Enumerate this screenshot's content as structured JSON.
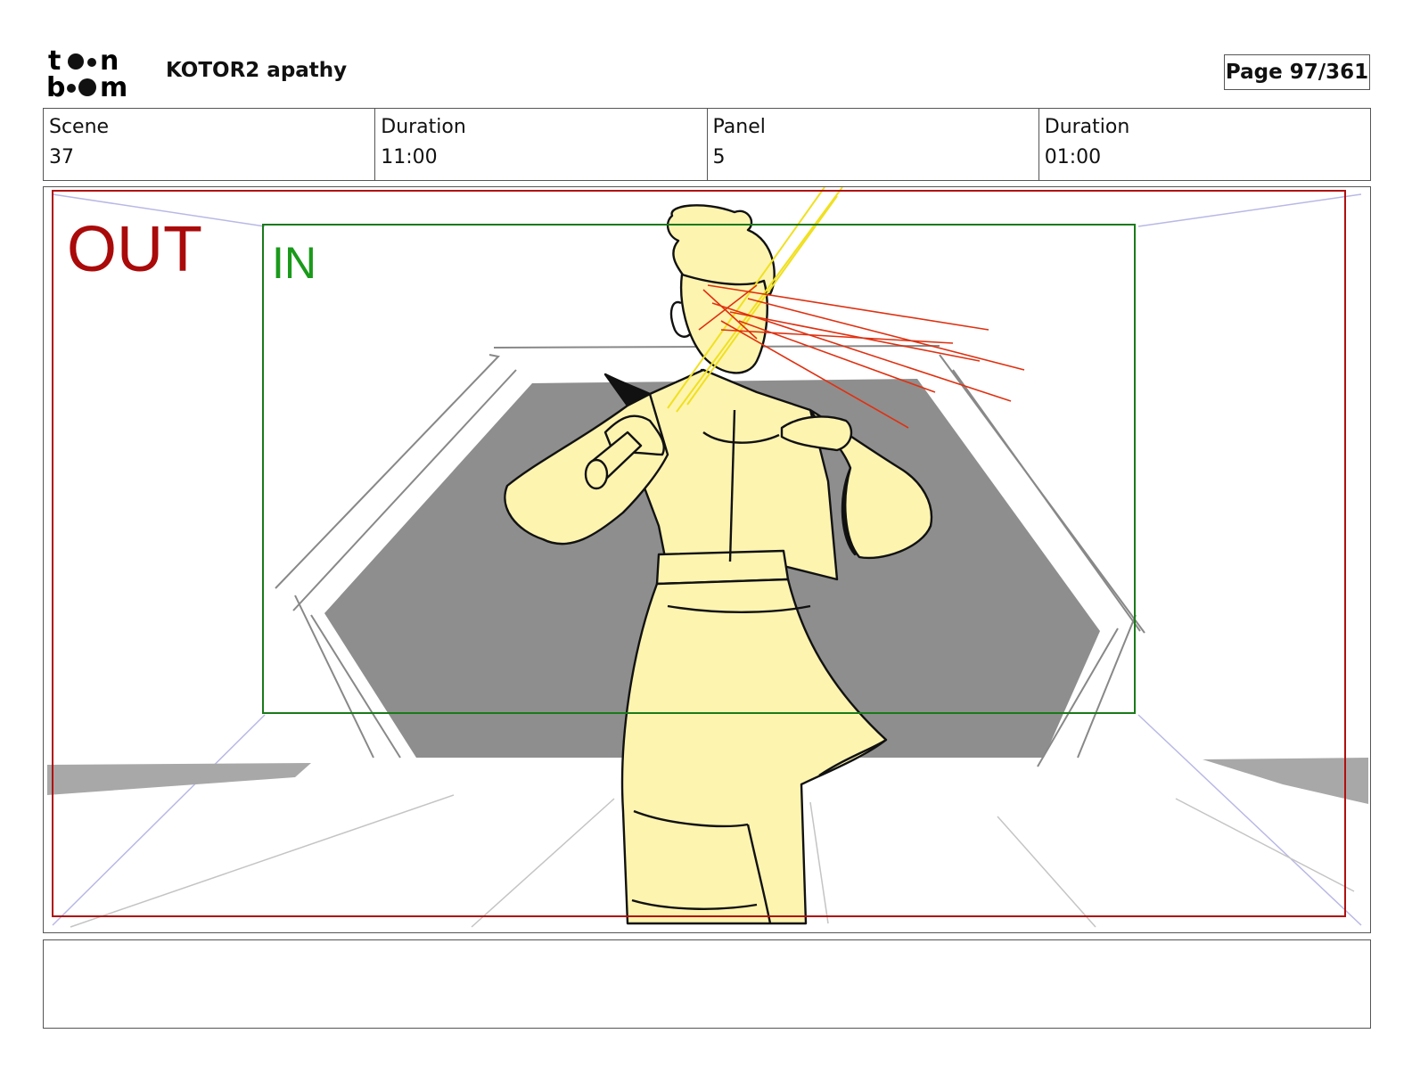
{
  "logo": {
    "text": "toon boom"
  },
  "header": {
    "project_title": "KOTOR2 apathy",
    "page_label": "Page 97/361"
  },
  "meta": {
    "scene_label": "Scene",
    "scene_value": "37",
    "duration_label": "Duration",
    "duration_value": "11:00",
    "panel_label": "Panel",
    "panel_value": "5",
    "panel_duration_label": "Duration",
    "panel_duration_value": "01:00"
  },
  "panel": {
    "out_label": "OUT",
    "in_label": "IN",
    "colors": {
      "out_frame": "#b01010",
      "in_frame": "#1a7a1a",
      "character_fill": "#fdf4b0",
      "wall": "#8e8e8e",
      "laser": "#e03010",
      "saber": "#f0e020"
    }
  },
  "caption": {
    "text": ""
  }
}
